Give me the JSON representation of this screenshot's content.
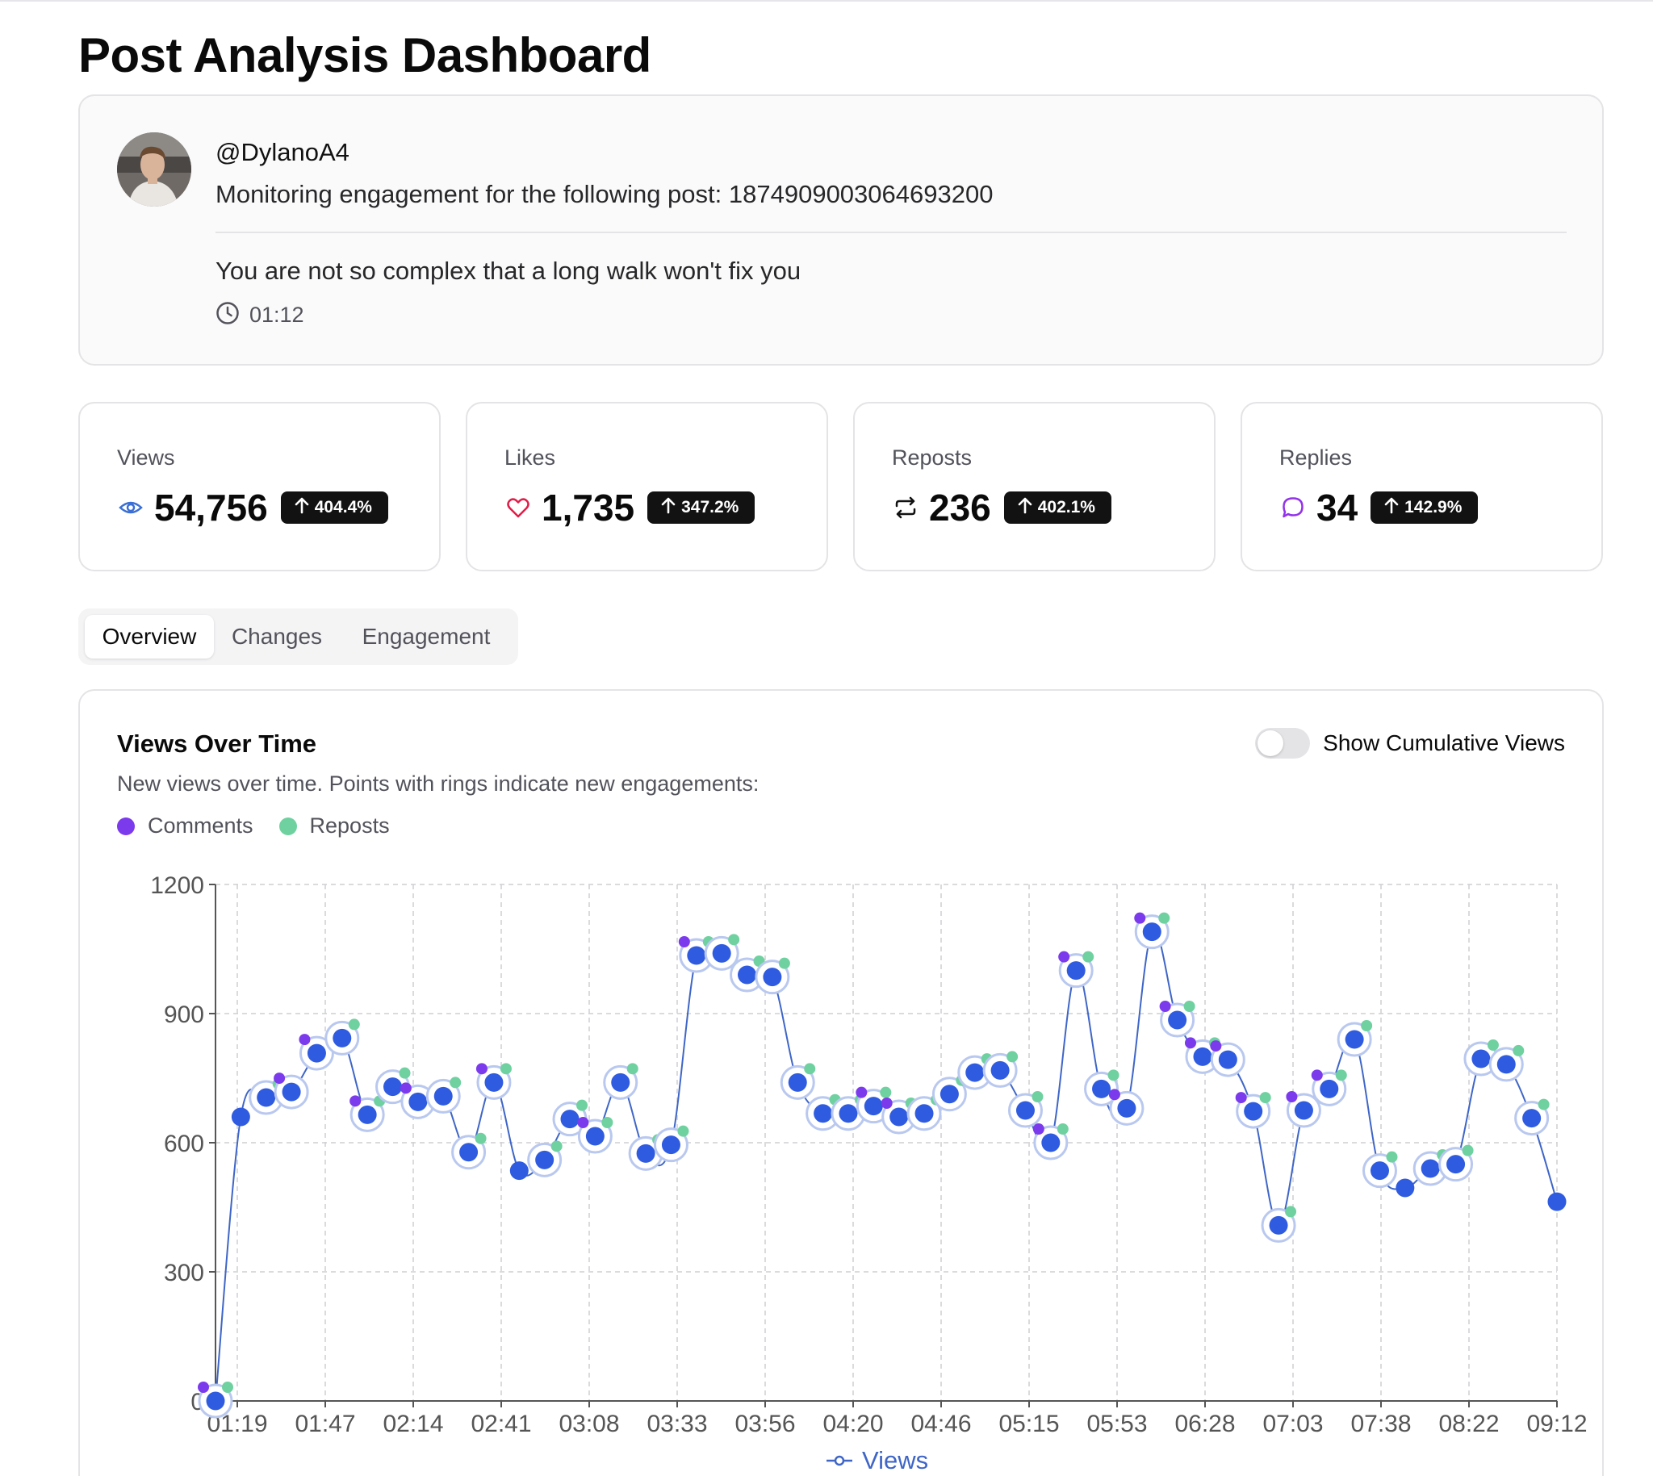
{
  "page": {
    "title": "Post Analysis Dashboard"
  },
  "post": {
    "handle": "@DylanoA4",
    "monitoring_text": "Monitoring engagement for the following post: 1874909003064693200",
    "text": "You are not so complex that a long walk won't fix you",
    "time": "01:12"
  },
  "stats": [
    {
      "label": "Views",
      "value": "54,756",
      "change": "404.4%",
      "icon": "eye-icon",
      "color": "#3b6fd4"
    },
    {
      "label": "Likes",
      "value": "1,735",
      "change": "347.2%",
      "icon": "heart-icon",
      "color": "#e11d48"
    },
    {
      "label": "Reposts",
      "value": "236",
      "change": "402.1%",
      "icon": "repost-icon",
      "color": "#111111"
    },
    {
      "label": "Replies",
      "value": "34",
      "change": "142.9%",
      "icon": "reply-icon",
      "color": "#9333ea"
    }
  ],
  "tabs": [
    {
      "label": "Overview",
      "active": true
    },
    {
      "label": "Changes",
      "active": false
    },
    {
      "label": "Engagement",
      "active": false
    }
  ],
  "chart_section": {
    "title": "Views Over Time",
    "subtitle": "New views over time. Points with rings indicate new engagements:",
    "legend": [
      {
        "label": "Comments",
        "color": "#7c3aed"
      },
      {
        "label": "Reposts",
        "color": "#6fd1a0"
      }
    ],
    "toggle_label": "Show Cumulative Views",
    "toggle_on": false,
    "series_label": "Views"
  },
  "colors": {
    "line": "#3f66c7",
    "point": "#2f5be0",
    "ring": "#b9c8ef",
    "grid": "#cfcfd4",
    "axis": "#555555"
  },
  "chart_data": {
    "type": "line",
    "ylim": [
      0,
      1200
    ],
    "yticks": [
      0,
      300,
      600,
      900,
      1200
    ],
    "xticks": [
      "01:19",
      "01:47",
      "02:14",
      "02:41",
      "03:08",
      "03:33",
      "03:56",
      "04:20",
      "04:46",
      "05:15",
      "05:53",
      "06:28",
      "07:03",
      "07:38",
      "08:22",
      "09:12"
    ],
    "series": [
      {
        "name": "Views"
      }
    ],
    "values": [
      0,
      660,
      705,
      718,
      808,
      843,
      665,
      730,
      695,
      708,
      578,
      740,
      535,
      560,
      655,
      615,
      740,
      575,
      595,
      1035,
      1040,
      990,
      985,
      740,
      668,
      668,
      685,
      660,
      668,
      713,
      763,
      768,
      675,
      600,
      1000,
      725,
      680,
      1090,
      885,
      800,
      793,
      673,
      408,
      675,
      725,
      840,
      535,
      495,
      540,
      550,
      795,
      782,
      657,
      463
    ],
    "comments": [
      1,
      0,
      0,
      1,
      1,
      0,
      1,
      0,
      1,
      0,
      0,
      1,
      0,
      0,
      0,
      1,
      0,
      0,
      0,
      1,
      0,
      0,
      0,
      0,
      0,
      0,
      1,
      1,
      0,
      0,
      0,
      0,
      0,
      1,
      1,
      0,
      1,
      1,
      1,
      1,
      1,
      1,
      0,
      1,
      1,
      0,
      0,
      0,
      0,
      0,
      0,
      0,
      0,
      0
    ],
    "reposts": [
      1,
      0,
      1,
      0,
      0,
      1,
      1,
      1,
      0,
      1,
      1,
      1,
      0,
      1,
      1,
      1,
      1,
      1,
      1,
      1,
      1,
      1,
      1,
      1,
      1,
      1,
      1,
      1,
      1,
      1,
      1,
      1,
      1,
      1,
      1,
      1,
      0,
      1,
      1,
      1,
      0,
      1,
      1,
      0,
      1,
      1,
      1,
      0,
      1,
      1,
      1,
      1,
      1,
      0
    ]
  }
}
